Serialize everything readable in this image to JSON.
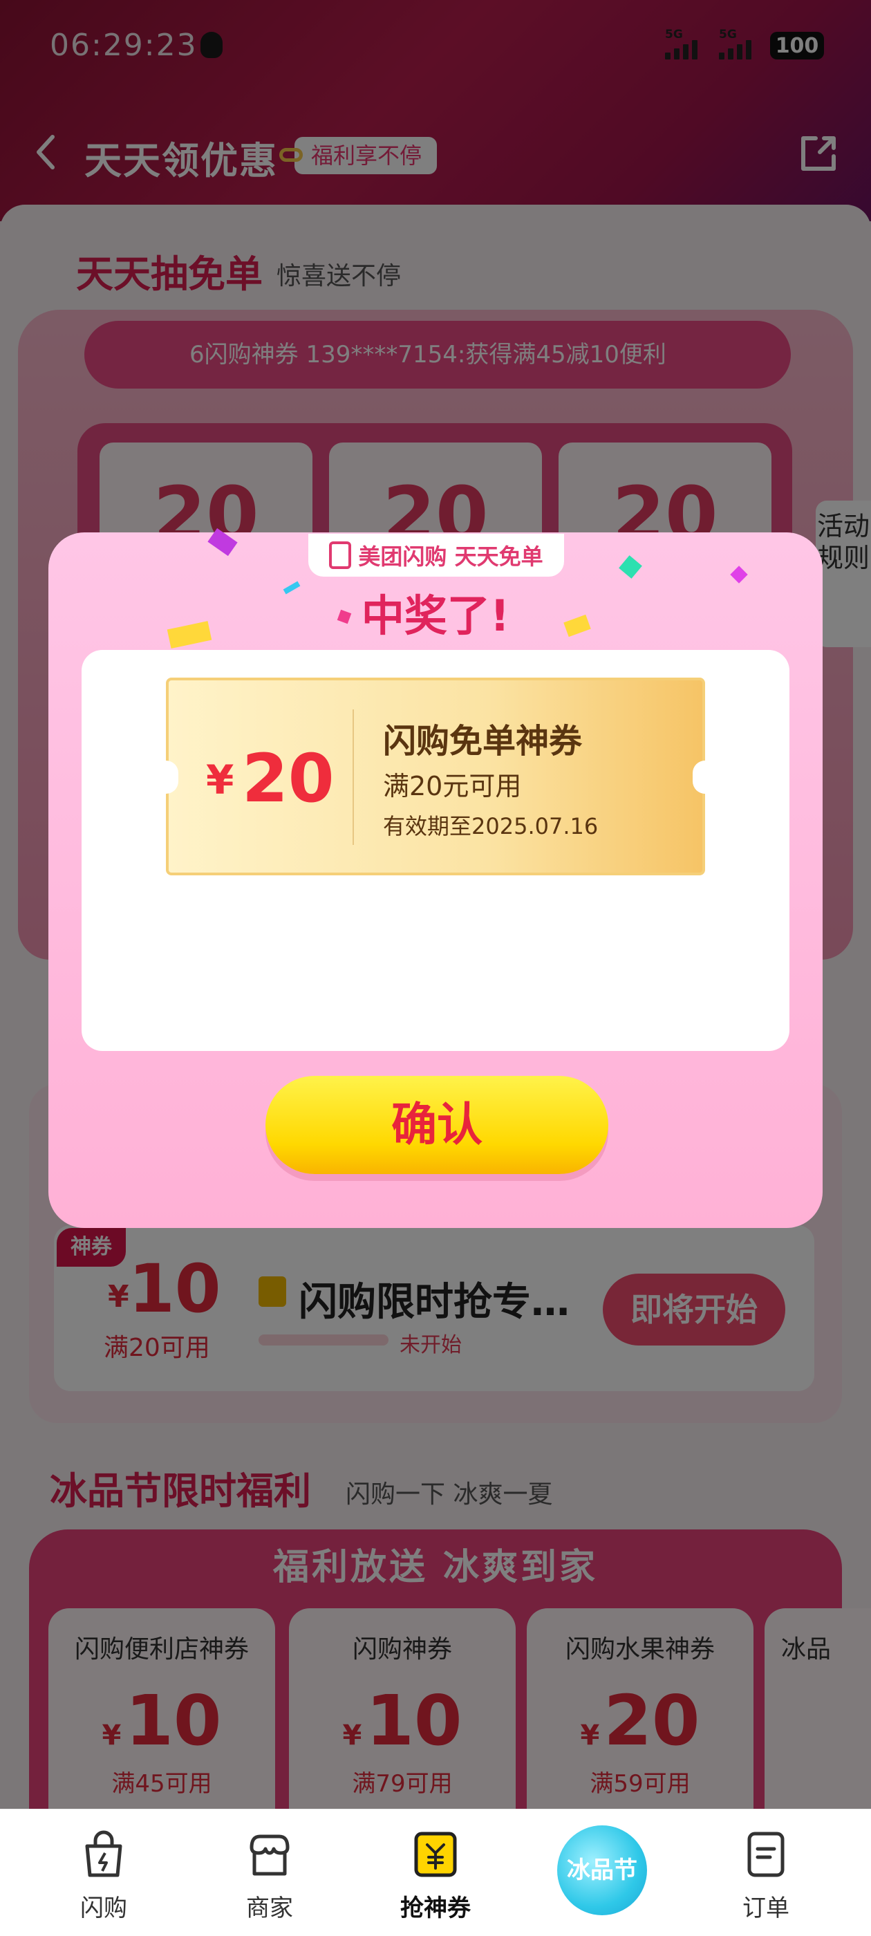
{
  "status_bar": {
    "time": "06:29:23",
    "signal1": "5G",
    "signal2": "5G",
    "battery": "100"
  },
  "nav": {
    "title": "天天领优惠",
    "badge": "福利享不停"
  },
  "rules_tab": "活动规则",
  "lottery": {
    "title": "天天抽免单",
    "subtitle": "惊喜送不停",
    "marquee": "6闪购神券   139****7154:获得满45减10便利",
    "slots": [
      "20",
      "20",
      "20"
    ]
  },
  "deal": {
    "tag": "神券",
    "currency": "¥",
    "amount": "10",
    "condition": "满20可用",
    "name": "闪购限时抢专…",
    "status": "未开始",
    "button": "即将开始"
  },
  "ice_section": {
    "title": "冰品节限时福利",
    "subtitle": "闪购一下 冰爽一夏",
    "banner": "福利放送 冰爽到家",
    "cards": [
      {
        "title": "闪购便利店神券",
        "currency": "¥",
        "amount": "10",
        "condition": "满45可用"
      },
      {
        "title": "闪购神券",
        "currency": "¥",
        "amount": "10",
        "condition": "满79可用"
      },
      {
        "title": "闪购水果神券",
        "currency": "¥",
        "amount": "20",
        "condition": "满59可用"
      },
      {
        "title": "冰品",
        "currency": "¥",
        "amount": "",
        "condition": ""
      }
    ]
  },
  "modal": {
    "header_badge": "美团闪购  天天免单",
    "title": "中奖了!",
    "coupon": {
      "currency": "¥",
      "amount": "20",
      "title": "闪购免单神券",
      "condition": "满20元可用",
      "expiry": "有效期至2025.07.16"
    },
    "confirm": "确认"
  },
  "tabbar": {
    "items": [
      {
        "label": "闪购",
        "icon": "shopping-bag-icon"
      },
      {
        "label": "商家",
        "icon": "store-icon"
      },
      {
        "label": "抢神券",
        "icon": "coupon-icon"
      },
      {
        "label": "冰品节",
        "icon": "ice-festival-icon"
      },
      {
        "label": "订单",
        "icon": "order-icon"
      }
    ]
  },
  "colors": {
    "accent": "#e0245c",
    "button_yellow": "#ffd800",
    "modal_pink": "#ffb9dc"
  }
}
